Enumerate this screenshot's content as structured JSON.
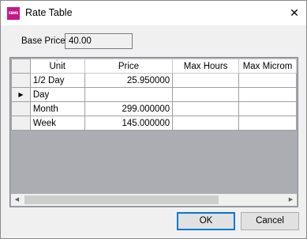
{
  "window": {
    "title": "Rate Table",
    "app_icon_text": "EBMS",
    "close_glyph": "✕"
  },
  "base_price": {
    "label": "Base Price:",
    "value": "40.00"
  },
  "grid": {
    "columns": [
      "Unit",
      "Price",
      "Max Hours",
      "Max Microm"
    ],
    "rows": [
      {
        "indicator": "",
        "unit": "1/2 Day",
        "price": "25.950000",
        "max_hours": "",
        "max_micro": ""
      },
      {
        "indicator": "▶",
        "unit": "Day",
        "price": "",
        "max_hours": "",
        "max_micro": ""
      },
      {
        "indicator": "",
        "unit": "Month",
        "price": "299.000000",
        "max_hours": "",
        "max_micro": ""
      },
      {
        "indicator": "",
        "unit": "Week",
        "price": "145.000000",
        "max_hours": "",
        "max_micro": ""
      }
    ],
    "scroll_left": "◀",
    "scroll_right": "▶",
    "sort_glyph": "▽"
  },
  "buttons": {
    "ok": "OK",
    "cancel": "Cancel"
  }
}
